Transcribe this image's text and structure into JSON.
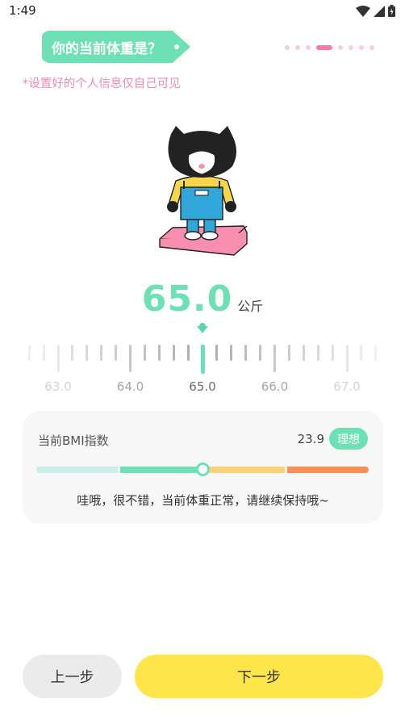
{
  "status_bar": {
    "time": "1:49",
    "icons": [
      "wifi-icon",
      "signal-icon",
      "battery-icon"
    ]
  },
  "question": {
    "text": "你的当前体重是？"
  },
  "progress": {
    "total_steps": 8,
    "current_step": 4
  },
  "privacy_note": "*设置好的个人信息仅自己可见",
  "weight": {
    "value": "65.0",
    "unit": "公斤"
  },
  "ruler": {
    "min": 62.0,
    "max": 67.6,
    "step": 0.2,
    "selected": 65.0,
    "labels": [
      "63.0",
      "64.0",
      "65.0",
      "66.0",
      "67.0"
    ]
  },
  "bmi": {
    "label": "当前BMI指数",
    "value": "23.9",
    "badge": "理想",
    "position": 0.5,
    "message": "哇哦，很不错，当前体重正常，请继续保持哦~"
  },
  "buttons": {
    "prev": "上一步",
    "next": "下一步"
  },
  "colors": {
    "accent": "#6ee0b6",
    "pink": "#f47ca7",
    "next_button": "#fee64a",
    "bmi_segments": [
      "#c9efe9",
      "#6ee0b6",
      "#fdd17a",
      "#fb8e52"
    ]
  }
}
